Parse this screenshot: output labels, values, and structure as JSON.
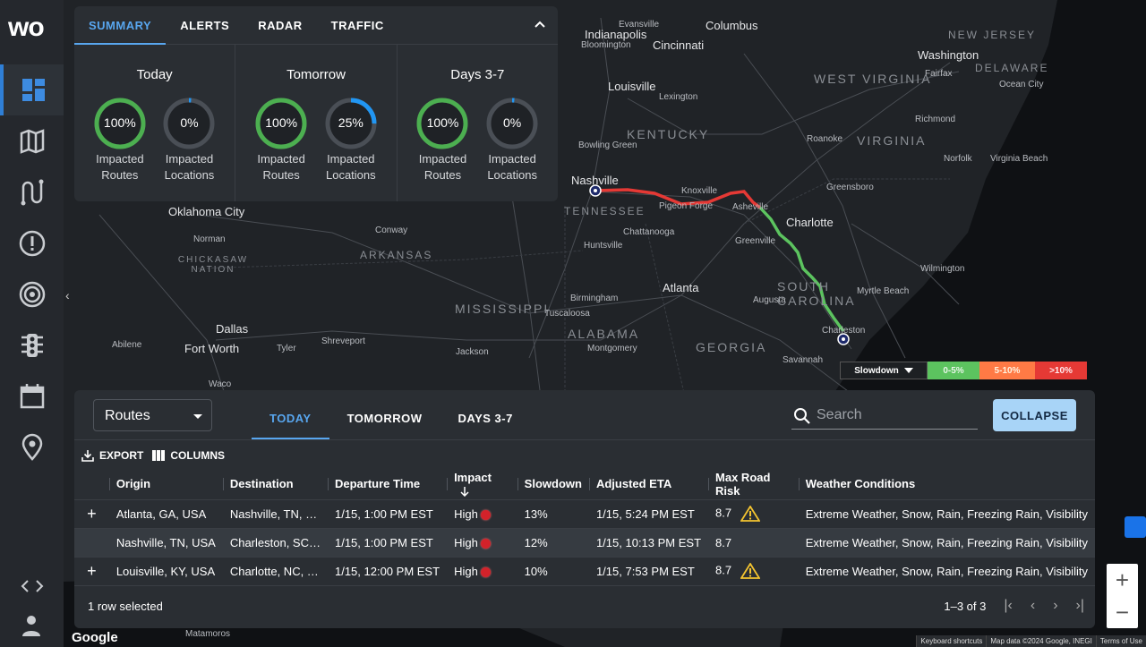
{
  "sidebar": {
    "logo": "wo",
    "items": [
      {
        "name": "dashboard",
        "active": true
      },
      {
        "name": "map",
        "active": false
      },
      {
        "name": "routes",
        "active": false
      },
      {
        "name": "alerts",
        "active": false
      },
      {
        "name": "radar",
        "active": false
      },
      {
        "name": "traffic",
        "active": false
      },
      {
        "name": "calendar",
        "active": false
      },
      {
        "name": "location",
        "active": false
      }
    ]
  },
  "summary": {
    "tabs": [
      "SUMMARY",
      "ALERTS",
      "RADAR",
      "TRAFFIC"
    ],
    "active_tab": "SUMMARY",
    "columns": [
      {
        "title": "Today",
        "gauges": [
          {
            "value": "100%",
            "pct": 100,
            "label1": "Impacted",
            "label2": "Routes",
            "color": "#4caf50"
          },
          {
            "value": "0%",
            "pct": 0,
            "label1": "Impacted",
            "label2": "Locations",
            "color": "#2196f3"
          }
        ]
      },
      {
        "title": "Tomorrow",
        "gauges": [
          {
            "value": "100%",
            "pct": 100,
            "label1": "Impacted",
            "label2": "Routes",
            "color": "#4caf50"
          },
          {
            "value": "25%",
            "pct": 25,
            "label1": "Impacted",
            "label2": "Locations",
            "color": "#2196f3"
          }
        ]
      },
      {
        "title": "Days 3-7",
        "gauges": [
          {
            "value": "100%",
            "pct": 100,
            "label1": "Impacted",
            "label2": "Routes",
            "color": "#4caf50"
          },
          {
            "value": "0%",
            "pct": 0,
            "label1": "Impacted",
            "label2": "Locations",
            "color": "#2196f3"
          }
        ]
      }
    ]
  },
  "legend": {
    "selector": "Slowdown",
    "items": [
      {
        "label": "0-5%",
        "color": "#5cc35f",
        "text_color": "#e8f5e9"
      },
      {
        "label": "5-10%",
        "color": "#ff7a45",
        "text_color": "#fff3e0"
      },
      {
        "label": ">10%",
        "color": "#e53935",
        "text_color": "#ffebee"
      }
    ]
  },
  "map": {
    "cities": [
      "Columbus",
      "Indianapolis",
      "Cincinnati",
      "Bloomington",
      "Louisville",
      "Lexington",
      "Washington",
      "Fairfax",
      "Ocean City",
      "Richmond",
      "Roanoke",
      "Norfolk",
      "Virginia Beach",
      "Greensboro",
      "Charlotte",
      "Wilmington",
      "Myrtle Beach",
      "Charleston",
      "Savannah",
      "Augusta",
      "Greenville",
      "Asheville",
      "Knoxville",
      "Pigeon Forge",
      "Nashville",
      "Bowling Green",
      "Chattanooga",
      "Huntsville",
      "Birmingham",
      "Tuscaloosa",
      "Montgomery",
      "Atlanta",
      "Jackson",
      "Shreveport",
      "Tyler",
      "Dallas",
      "Fort Worth",
      "Abilene",
      "Waco",
      "Oklahoma City",
      "Norman",
      "Conway",
      "Matamoros",
      "Evansville"
    ],
    "states": [
      "NEW JERSEY",
      "DELAWARE",
      "WEST VIRGINIA",
      "VIRGINIA",
      "KENTUCKY",
      "TENNESSEE",
      "SOUTH CAROLINA",
      "ARKANSAS",
      "MISSISSIPPI",
      "ALABAMA",
      "GEORGIA",
      "CHICKASAW NATION"
    ],
    "footer": [
      "Keyboard shortcuts",
      "Map data ©2024 Google, INEGI",
      "Terms of Use"
    ],
    "google": "Google"
  },
  "routes_panel": {
    "selector": "Routes",
    "tabs": [
      "TODAY",
      "TOMORROW",
      "DAYS 3-7"
    ],
    "active_tab": "TODAY",
    "search_placeholder": "Search",
    "collapse_label": "COLLAPSE",
    "export_label": "EXPORT",
    "columns_label": "COLUMNS",
    "headers": [
      "Origin",
      "Destination",
      "Departure Time",
      "Impact",
      "Slowdown",
      "Adjusted ETA",
      "Max Road Risk",
      "Weather Conditions"
    ],
    "rows": [
      {
        "expand": "+",
        "origin": "Atlanta, GA, USA",
        "destination": "Nashville, TN, …",
        "departure": "1/15, 1:00 PM EST",
        "impact": "High",
        "slowdown": "13%",
        "eta": "1/15, 5:24 PM EST",
        "risk": "8.7",
        "warning": true,
        "weather": "Extreme Weather, Snow, Rain, Freezing Rain, Visibility",
        "selected": false
      },
      {
        "expand": "",
        "origin": "Nashville, TN, USA",
        "destination": "Charleston, SC…",
        "departure": "1/15, 1:00 PM EST",
        "impact": "High",
        "slowdown": "12%",
        "eta": "1/15, 10:13 PM EST",
        "risk": "8.7",
        "warning": false,
        "weather": "Extreme Weather, Snow, Rain, Freezing Rain, Visibility",
        "selected": true
      },
      {
        "expand": "+",
        "origin": "Louisville, KY, USA",
        "destination": "Charlotte, NC, …",
        "departure": "1/15, 12:00 PM EST",
        "impact": "High",
        "slowdown": "10%",
        "eta": "1/15, 7:53 PM EST",
        "risk": "8.7",
        "warning": true,
        "weather": "Extreme Weather, Snow, Rain, Freezing Rain, Visibility",
        "selected": false
      }
    ],
    "selected_text": "1 row selected",
    "pagination": "1–3 of 3"
  }
}
